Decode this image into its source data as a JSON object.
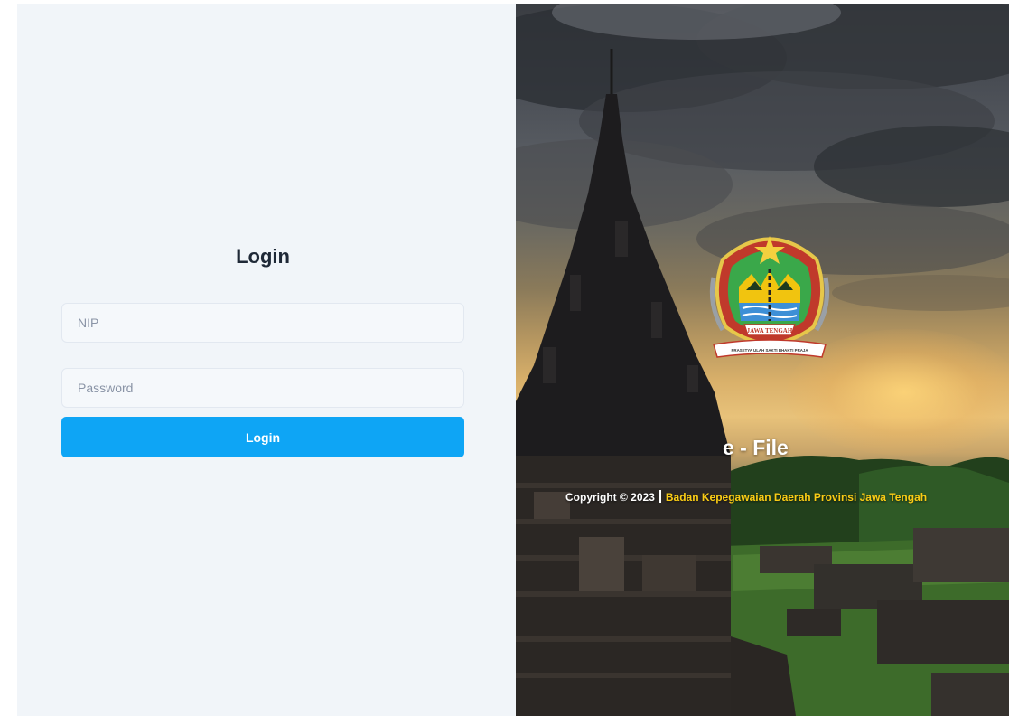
{
  "login": {
    "title": "Login",
    "nip_placeholder": "NIP",
    "password_placeholder": "Password",
    "button_label": "Login"
  },
  "brand": {
    "app_name": "e - File",
    "emblem_banner": "JAWA TENGAH",
    "emblem_motto": "PRASETYA ULAH SAKTI BHAKTI PRAJA",
    "copyright_prefix": "Copyright © 2023",
    "copyright_org": "Badan Kepegawaian Daerah Provinsi Jawa Tengah"
  },
  "colors": {
    "left_panel_bg": "#f1f5f9",
    "button_bg": "#0ea5f5",
    "org_text": "#facc15"
  },
  "icons": {
    "emblem": "jawa-tengah-emblem"
  }
}
